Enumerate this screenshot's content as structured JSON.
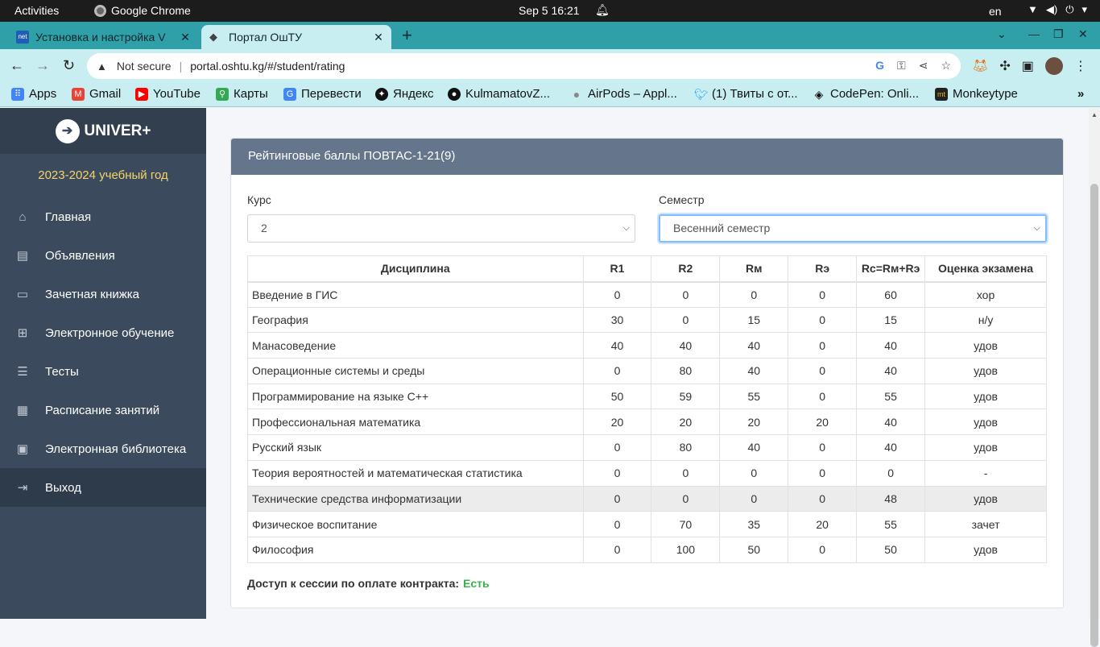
{
  "os_bar": {
    "activities": "Activities",
    "app_name": "Google Chrome",
    "clock": "Sep 5  16:21",
    "lang": "en"
  },
  "tabs": [
    {
      "title": "Установка и настройка V",
      "favicon": "net",
      "close": "✕"
    },
    {
      "title": "Портал ОшТУ",
      "favicon": "◆",
      "close": "✕"
    }
  ],
  "new_tab": "+",
  "address": {
    "security": "Not secure",
    "url": "portal.oshtu.kg/#/student/rating"
  },
  "bookmarks": [
    {
      "label": "Apps",
      "icon": "apps-grid-icon",
      "color": "#4285f4"
    },
    {
      "label": "Gmail",
      "icon": "gmail-icon",
      "color": "#ea4335"
    },
    {
      "label": "YouTube",
      "icon": "youtube-icon",
      "color": "#ff0000"
    },
    {
      "label": "Карты",
      "icon": "maps-icon",
      "color": "#34a853"
    },
    {
      "label": "Перевести",
      "icon": "translate-icon",
      "color": "#4285f4"
    },
    {
      "label": "Яндекс",
      "icon": "yandex-icon",
      "color": "#111111"
    },
    {
      "label": "KulmamatovZ...",
      "icon": "github-icon",
      "color": "#111111"
    },
    {
      "label": "AirPods – Appl...",
      "icon": "apple-icon",
      "color": "#888888"
    },
    {
      "label": "(1) Твиты с от...",
      "icon": "twitter-icon",
      "color": "#1da1f2"
    },
    {
      "label": "CodePen: Onli...",
      "icon": "codepen-icon",
      "color": "#111111"
    },
    {
      "label": "Monkeytype",
      "icon": "monkeytype-icon",
      "color": "#222222"
    }
  ],
  "sidebar": {
    "brand": "UNIVER+",
    "year": "2023-2024 учебный год",
    "items": [
      {
        "label": "Главная",
        "icon": "home-icon"
      },
      {
        "label": "Объявления",
        "icon": "announcements-icon"
      },
      {
        "label": "Зачетная книжка",
        "icon": "record-book-icon"
      },
      {
        "label": "Электронное обучение",
        "icon": "e-learning-icon"
      },
      {
        "label": "Тесты",
        "icon": "tests-icon"
      },
      {
        "label": "Расписание занятий",
        "icon": "calendar-icon"
      },
      {
        "label": "Электронная библиотека",
        "icon": "library-icon"
      },
      {
        "label": "Выход",
        "icon": "logout-icon"
      }
    ]
  },
  "card": {
    "title": "Рейтинговые баллы ПОВТАС-1-21(9)",
    "course_label": "Курс",
    "course_value": "2",
    "semester_label": "Семестр",
    "semester_value": "Весенний семестр"
  },
  "table": {
    "headers": [
      "Дисциплина",
      "R1",
      "R2",
      "Rм",
      "Rэ",
      "Rc=Rм+Rэ",
      "Оценка экзамена"
    ],
    "rows": [
      [
        "Введение в ГИС",
        "0",
        "0",
        "0",
        "0",
        "60",
        "хор"
      ],
      [
        "География",
        "30",
        "0",
        "15",
        "0",
        "15",
        "н/у"
      ],
      [
        "Манасоведение",
        "40",
        "40",
        "40",
        "0",
        "40",
        "удов"
      ],
      [
        "Операционные системы и среды",
        "0",
        "80",
        "40",
        "0",
        "40",
        "удов"
      ],
      [
        "Программирование на языке С++",
        "50",
        "59",
        "55",
        "0",
        "55",
        "удов"
      ],
      [
        "Профессиональная математика",
        "20",
        "20",
        "20",
        "20",
        "40",
        "удов"
      ],
      [
        "Русский язык",
        "0",
        "80",
        "40",
        "0",
        "40",
        "удов"
      ],
      [
        "Теория вероятностей и математическая статистика",
        "0",
        "0",
        "0",
        "0",
        "0",
        "-"
      ],
      [
        "Технические средства информатизации",
        "0",
        "0",
        "0",
        "0",
        "48",
        "удов"
      ],
      [
        "Физическое воспитание",
        "0",
        "70",
        "35",
        "20",
        "55",
        "зачет"
      ],
      [
        "Философия",
        "0",
        "100",
        "50",
        "0",
        "50",
        "удов"
      ]
    ]
  },
  "access": {
    "label": "Доступ к сессии по оплате контракта:",
    "value": "Есть",
    "value_color": "#36b34d"
  },
  "colors": {
    "tab_strip": "#2f9fa8",
    "toolbar": "#c9eef2",
    "sidebar": "#3b4a5c",
    "card_header": "#65758b",
    "year_text": "#f5d36b"
  }
}
